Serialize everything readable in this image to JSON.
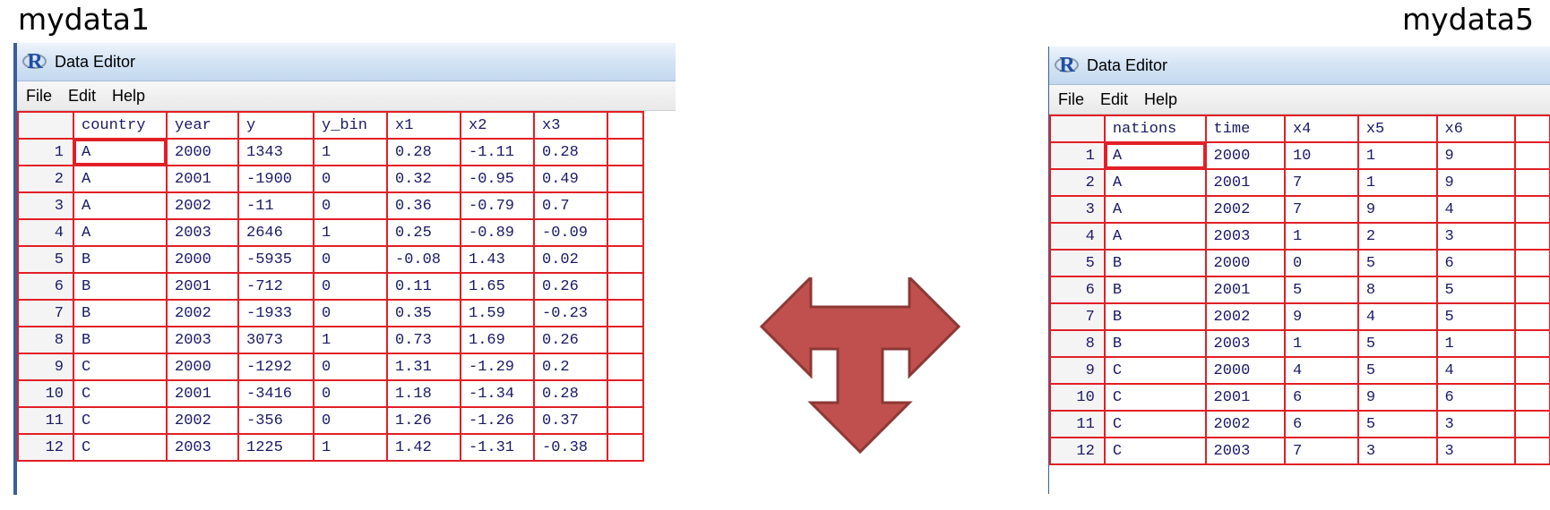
{
  "captions": {
    "left": "mydata1",
    "right": "mydata5"
  },
  "left_editor": {
    "title": "Data Editor",
    "logo_letter": "R",
    "menu": [
      "File",
      "Edit",
      "Help"
    ],
    "columns": [
      "country",
      "year",
      "y",
      "y_bin",
      "x1",
      "x2",
      "x3"
    ],
    "rows": [
      [
        "1",
        "A",
        "2000",
        "1343",
        "1",
        "0.28",
        "-1.11",
        "0.28"
      ],
      [
        "2",
        "A",
        "2001",
        "-1900",
        "0",
        "0.32",
        "-0.95",
        "0.49"
      ],
      [
        "3",
        "A",
        "2002",
        "-11",
        "0",
        "0.36",
        "-0.79",
        "0.7"
      ],
      [
        "4",
        "A",
        "2003",
        "2646",
        "1",
        "0.25",
        "-0.89",
        "-0.09"
      ],
      [
        "5",
        "B",
        "2000",
        "-5935",
        "0",
        "-0.08",
        "1.43",
        "0.02"
      ],
      [
        "6",
        "B",
        "2001",
        "-712",
        "0",
        "0.11",
        "1.65",
        "0.26"
      ],
      [
        "7",
        "B",
        "2002",
        "-1933",
        "0",
        "0.35",
        "1.59",
        "-0.23"
      ],
      [
        "8",
        "B",
        "2003",
        "3073",
        "1",
        "0.73",
        "1.69",
        "0.26"
      ],
      [
        "9",
        "C",
        "2000",
        "-1292",
        "0",
        "1.31",
        "-1.29",
        "0.2"
      ],
      [
        "10",
        "C",
        "2001",
        "-3416",
        "0",
        "1.18",
        "-1.34",
        "0.28"
      ],
      [
        "11",
        "C",
        "2002",
        "-356",
        "0",
        "1.26",
        "-1.26",
        "0.37"
      ],
      [
        "12",
        "C",
        "2003",
        "1225",
        "1",
        "1.42",
        "-1.31",
        "-0.38"
      ]
    ]
  },
  "right_editor": {
    "title": "Data Editor",
    "logo_letter": "R",
    "menu": [
      "File",
      "Edit",
      "Help"
    ],
    "columns": [
      "nations",
      "time",
      "x4",
      "x5",
      "x6"
    ],
    "rows": [
      [
        "1",
        "A",
        "2000",
        "10",
        "1",
        "9"
      ],
      [
        "2",
        "A",
        "2001",
        "7",
        "1",
        "9"
      ],
      [
        "3",
        "A",
        "2002",
        "7",
        "9",
        "4"
      ],
      [
        "4",
        "A",
        "2003",
        "1",
        "2",
        "3"
      ],
      [
        "5",
        "B",
        "2000",
        "0",
        "5",
        "6"
      ],
      [
        "6",
        "B",
        "2001",
        "5",
        "8",
        "5"
      ],
      [
        "7",
        "B",
        "2002",
        "9",
        "4",
        "5"
      ],
      [
        "8",
        "B",
        "2003",
        "1",
        "5",
        "1"
      ],
      [
        "9",
        "C",
        "2000",
        "4",
        "5",
        "4"
      ],
      [
        "10",
        "C",
        "2001",
        "6",
        "9",
        "6"
      ],
      [
        "11",
        "C",
        "2002",
        "6",
        "5",
        "3"
      ],
      [
        "12",
        "C",
        "2003",
        "7",
        "3",
        "3"
      ]
    ]
  },
  "colors": {
    "grid_border": "#e21f26",
    "cell_text": "#1a1a66",
    "arrow_fill": "#c0504d",
    "arrow_stroke": "#8c3836"
  },
  "icons": {
    "arrow": "three-way-arrow-icon",
    "app": "r-logo-icon"
  }
}
